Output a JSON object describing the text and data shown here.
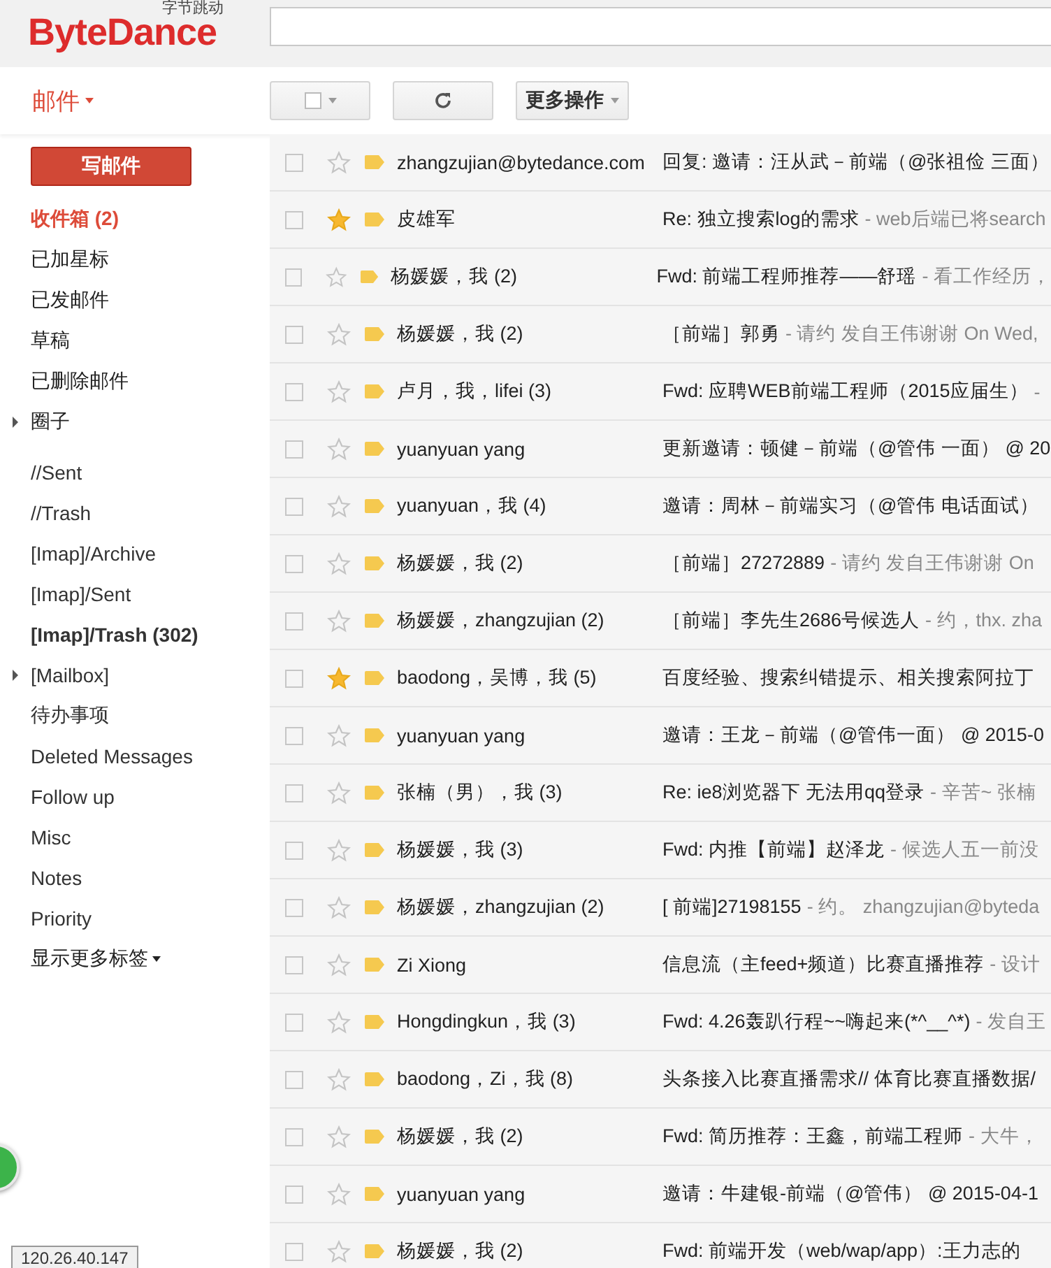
{
  "logo": {
    "name": "ByteDance",
    "tagline": "字节跳动"
  },
  "header": {
    "search": {
      "kind": "field"
    }
  },
  "app_menu": {
    "label": "邮件"
  },
  "toolbar": {
    "select_checked": false,
    "more_actions": "更多操作"
  },
  "sidebar": {
    "compose": "写邮件",
    "system_folders": [
      {
        "label": "收件箱 (2)",
        "selected": true,
        "bold": true,
        "kind": "folder"
      },
      {
        "label": "已加星标",
        "selected": false,
        "bold": false,
        "kind": "folder"
      },
      {
        "label": "已发邮件",
        "selected": false,
        "bold": false,
        "kind": "folder"
      },
      {
        "label": "草稿",
        "selected": false,
        "bold": false,
        "kind": "folder"
      },
      {
        "label": "已删除邮件",
        "selected": false,
        "bold": false,
        "kind": "folder"
      },
      {
        "label": "圈子",
        "selected": false,
        "bold": false,
        "kind": "group"
      }
    ],
    "labels": [
      {
        "label": "//Sent",
        "selected": false,
        "bold": false,
        "kind": "folder"
      },
      {
        "label": "//Trash",
        "selected": false,
        "bold": false,
        "kind": "folder"
      },
      {
        "label": "[Imap]/Archive",
        "selected": false,
        "bold": false,
        "kind": "folder"
      },
      {
        "label": "[Imap]/Sent",
        "selected": false,
        "bold": false,
        "kind": "folder"
      },
      {
        "label": "[Imap]/Trash (302)",
        "selected": false,
        "bold": true,
        "kind": "folder"
      },
      {
        "label": "[Mailbox]",
        "selected": false,
        "bold": false,
        "kind": "group"
      },
      {
        "label": "待办事项",
        "selected": false,
        "bold": false,
        "kind": "folder"
      },
      {
        "label": "Deleted Messages",
        "selected": false,
        "bold": false,
        "kind": "folder"
      },
      {
        "label": "Follow up",
        "selected": false,
        "bold": false,
        "kind": "folder"
      },
      {
        "label": "Misc",
        "selected": false,
        "bold": false,
        "kind": "folder"
      },
      {
        "label": "Notes",
        "selected": false,
        "bold": false,
        "kind": "folder"
      },
      {
        "label": "Priority",
        "selected": false,
        "bold": false,
        "kind": "folder"
      }
    ],
    "more_labels": "显示更多标签"
  },
  "messages": [
    {
      "checked": false,
      "starred": false,
      "sender": "zhangzujian@bytedance.com",
      "subject": "回复: 邀请：汪从武－前端（@张祖俭 三面）"
    },
    {
      "checked": false,
      "starred": true,
      "sender": "皮雄军",
      "subject": "Re: 独立搜索log的需求",
      "snippet": "- web后端已将search"
    },
    {
      "checked": false,
      "starred": false,
      "sender": "杨媛媛，我 (2)",
      "subject": "Fwd: 前端工程师推荐——舒瑶",
      "snippet": "- 看工作经历，"
    },
    {
      "checked": false,
      "starred": false,
      "sender": "杨媛媛，我 (2)",
      "subject": "［前端］郭勇",
      "snippet": "- 请约 发自王伟谢谢 On Wed,"
    },
    {
      "checked": false,
      "starred": false,
      "sender": "卢月，我，lifei (3)",
      "subject": "Fwd: 应聘WEB前端工程师（2015应届生）",
      "snippet": "-"
    },
    {
      "checked": false,
      "starred": false,
      "sender": "yuanyuan yang",
      "subject": "更新邀请：顿健－前端（@管伟 一面） @ 20"
    },
    {
      "checked": false,
      "starred": false,
      "sender": "yuanyuan，我 (4)",
      "subject": "邀请：周林－前端实习（@管伟 电话面试）"
    },
    {
      "checked": false,
      "starred": false,
      "sender": "杨媛媛，我 (2)",
      "subject": "［前端］27272889",
      "snippet": "- 请约 发自王伟谢谢 On"
    },
    {
      "checked": false,
      "starred": false,
      "sender": "杨媛媛，zhangzujian (2)",
      "subject": "［前端］李先生2686号候选人",
      "snippet": "- 约，thx. zha"
    },
    {
      "checked": false,
      "starred": true,
      "sender": "baodong，吴博，我 (5)",
      "subject": "百度经验、搜索纠错提示、相关搜索阿拉丁"
    },
    {
      "checked": false,
      "starred": false,
      "sender": "yuanyuan yang",
      "subject": "邀请：王龙－前端（@管伟一面） @ 2015-0"
    },
    {
      "checked": false,
      "starred": false,
      "sender": "张楠（男），我 (3)",
      "subject": "Re: ie8浏览器下 无法用qq登录",
      "snippet": "- 辛苦~ 张楠"
    },
    {
      "checked": false,
      "starred": false,
      "sender": "杨媛媛，我 (3)",
      "subject": "Fwd: 内推【前端】赵泽龙",
      "snippet": "- 候选人五一前没"
    },
    {
      "checked": false,
      "starred": false,
      "sender": "杨媛媛，zhangzujian (2)",
      "subject": "[ 前端]27198155",
      "snippet": "- 约。 zhangzujian@byteda"
    },
    {
      "checked": false,
      "starred": false,
      "sender": "Zi Xiong",
      "subject": "信息流（主feed+频道）比赛直播推荐",
      "snippet": "- 设计"
    },
    {
      "checked": false,
      "starred": false,
      "sender": "Hongdingkun，我 (3)",
      "subject": "Fwd: 4.26轰趴行程~~嗨起来(*^__^*)",
      "snippet": "- 发自王"
    },
    {
      "checked": false,
      "starred": false,
      "sender": "baodong，Zi，我 (8)",
      "subject": "头条接入比赛直播需求// 体育比赛直播数据/"
    },
    {
      "checked": false,
      "starred": false,
      "sender": "杨媛媛，我 (2)",
      "subject": "Fwd: 简历推荐：王鑫，前端工程师",
      "snippet": "- 大牛，"
    },
    {
      "checked": false,
      "starred": false,
      "sender": "yuanyuan yang",
      "subject": "邀请：牛建银-前端（@管伟） @ 2015-04-1"
    },
    {
      "checked": false,
      "starred": false,
      "sender": "杨媛媛，我 (2)",
      "subject": "Fwd: 前端开发（web/wap/app）:王力志的"
    }
  ],
  "status_tooltip": "120.26.40.147"
}
